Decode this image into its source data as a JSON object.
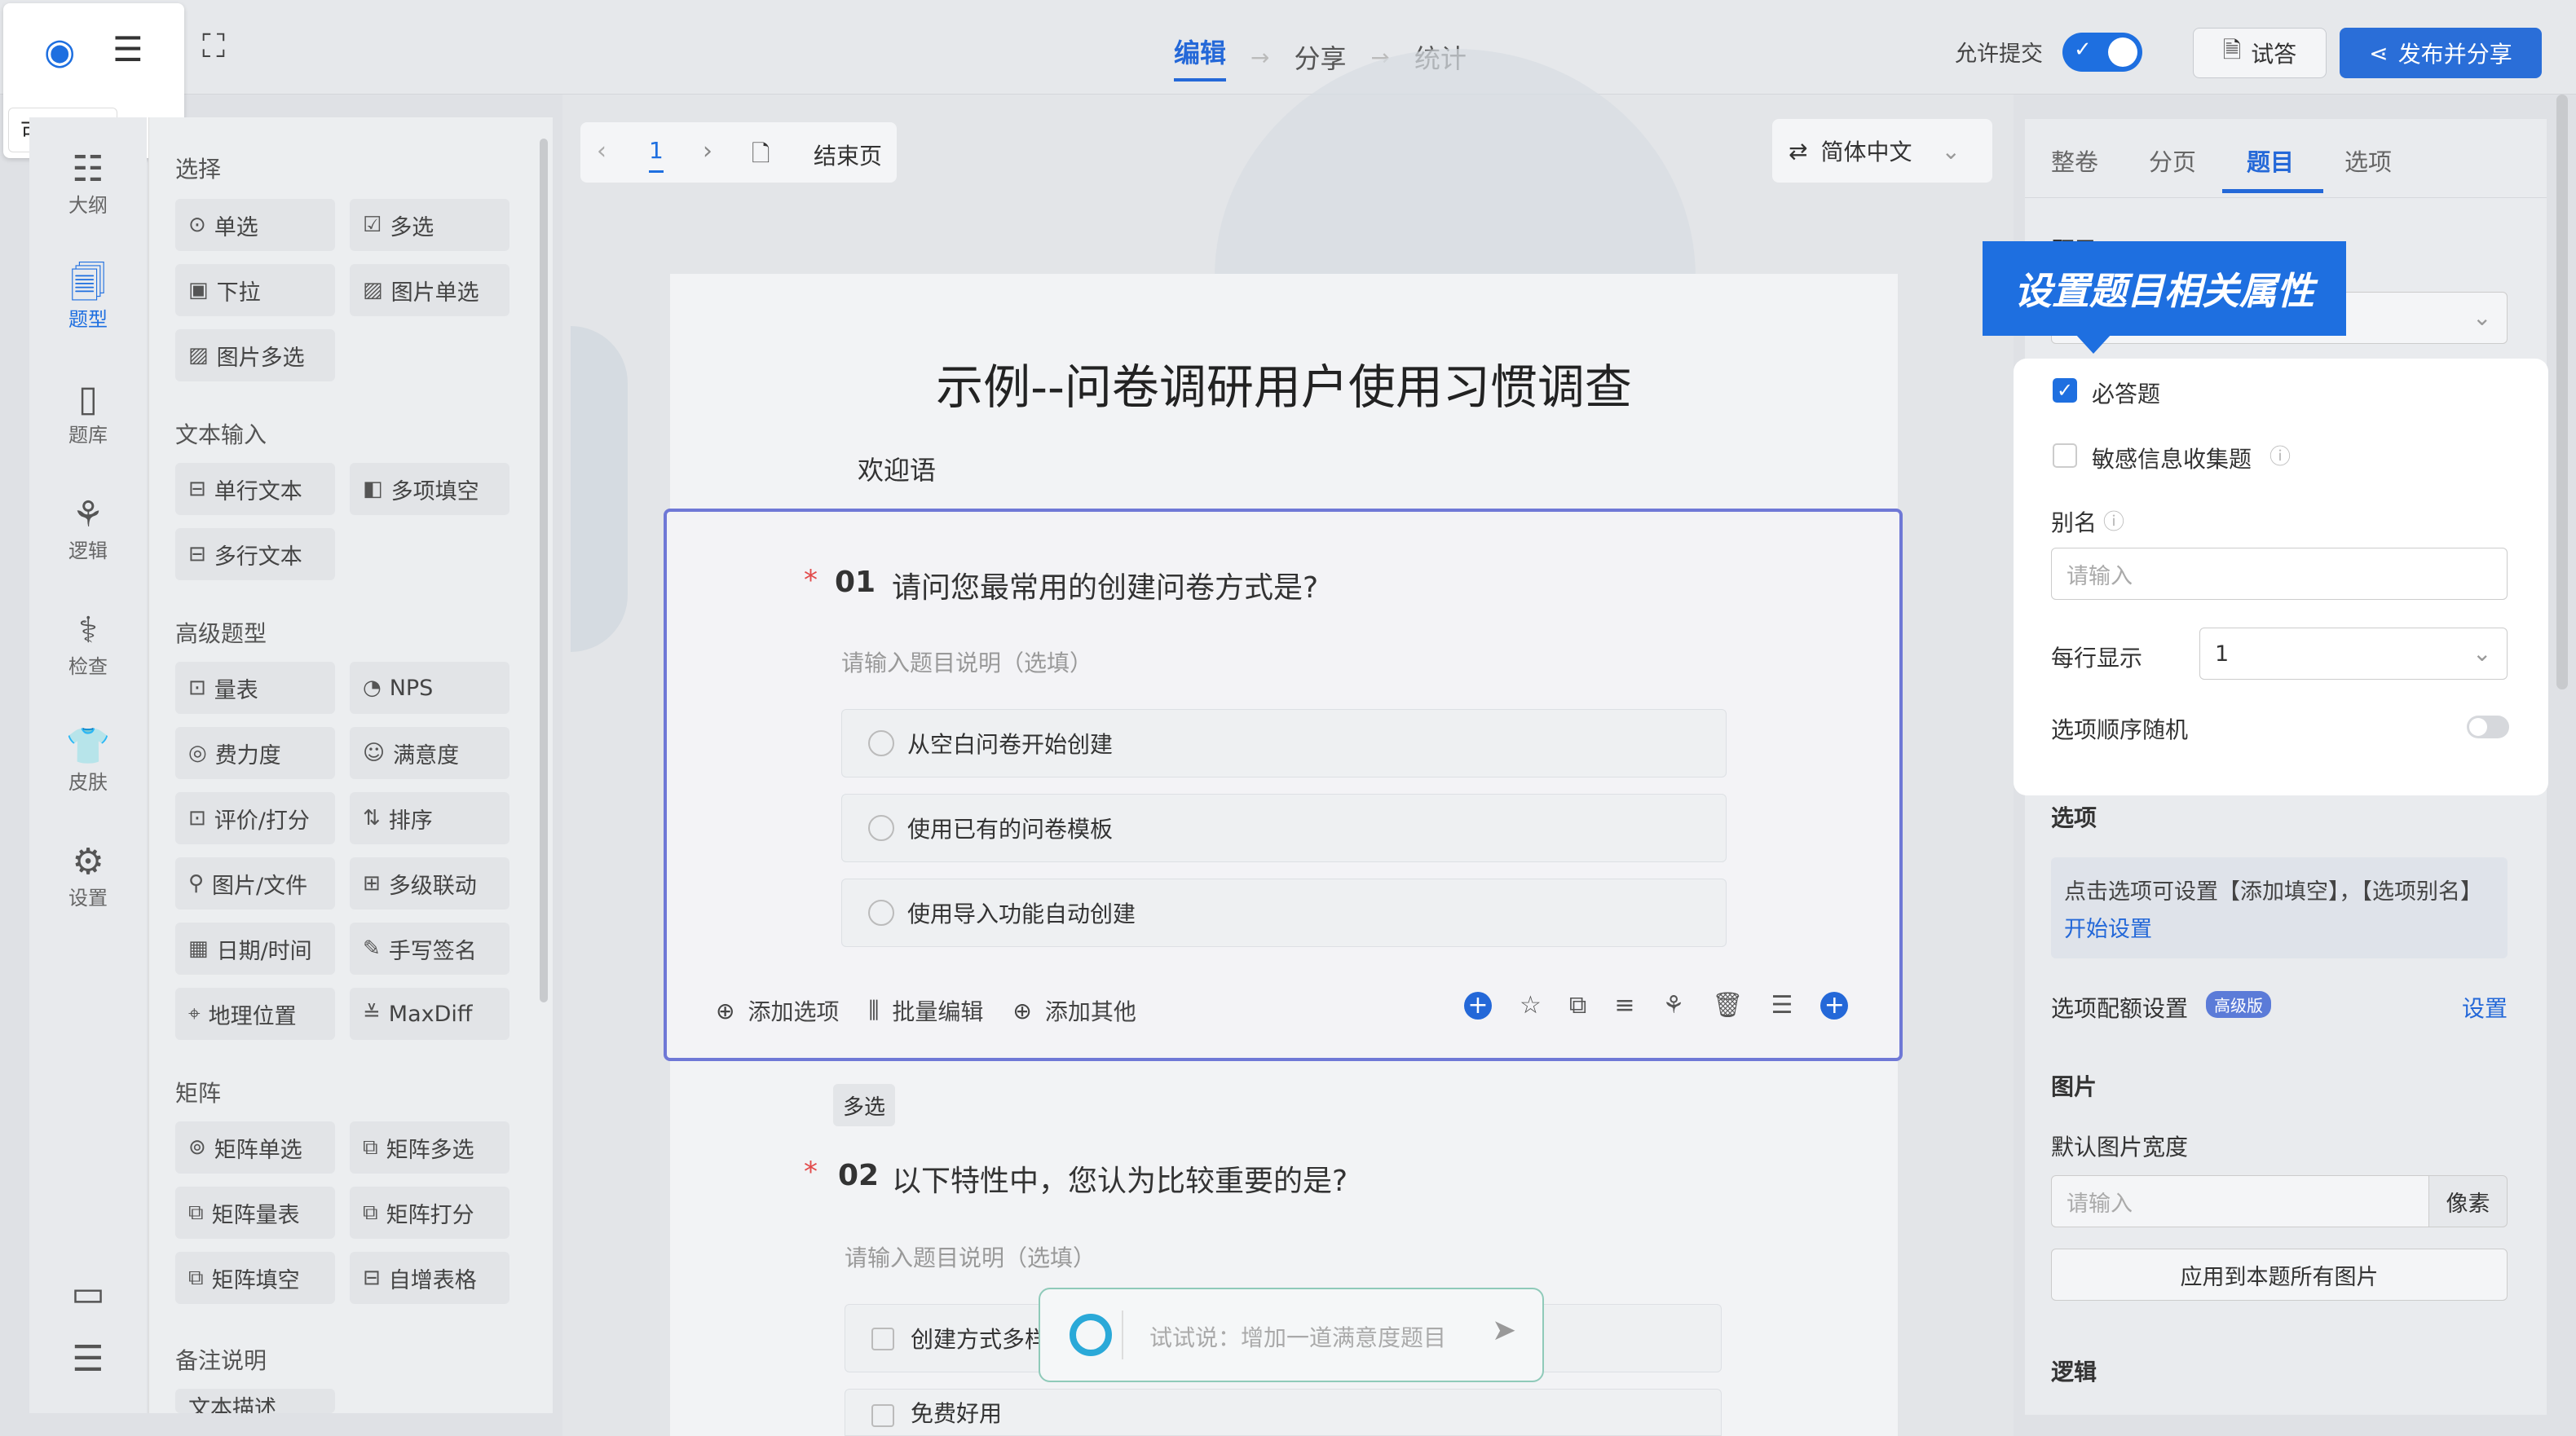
{
  "topbar": {
    "preview_tooltip": "可视模式",
    "steps": [
      "编辑",
      "分享",
      "统计"
    ],
    "allow_submit_label": "允许提交",
    "try_label": "试答",
    "publish_label": "发布并分享"
  },
  "leftnav": {
    "items": [
      "大纲",
      "题型",
      "题库",
      "逻辑",
      "检查",
      "皮肤",
      "设置"
    ]
  },
  "question_types": {
    "sections": [
      "选择",
      "文本输入",
      "高级题型",
      "矩阵",
      "备注说明"
    ],
    "choice": [
      "单选",
      "多选",
      "下拉",
      "图片单选",
      "图片多选"
    ],
    "text": [
      "单行文本",
      "多项填空",
      "多行文本"
    ],
    "advanced": [
      "量表",
      "NPS",
      "费力度",
      "满意度",
      "评价/打分",
      "排序",
      "图片/文件",
      "多级联动",
      "日期/时间",
      "手写签名",
      "地理位置",
      "MaxDiff"
    ],
    "matrix": [
      "矩阵单选",
      "矩阵多选",
      "矩阵量表",
      "矩阵打分",
      "矩阵填空",
      "自增表格"
    ],
    "remark_partial": "文本描述"
  },
  "page_nav": {
    "page": "1",
    "end_page": "结束页"
  },
  "language": "简体中文",
  "survey": {
    "title": "示例--问卷调研用户使用习惯调查",
    "welcome": "欢迎语",
    "q1": {
      "number": "01",
      "text": "请问您最常用的创建问卷方式是?",
      "desc_placeholder": "请输入题目说明（选填）",
      "options": [
        "从空白问卷开始创建",
        "使用已有的问卷模板",
        "使用导入功能自动创建"
      ],
      "add_option": "添加选项",
      "batch_edit": "批量编辑",
      "add_other": "添加其他"
    },
    "q2": {
      "type_badge": "多选",
      "number": "02",
      "text": "以下特性中，您认为比较重要的是?",
      "desc_placeholder": "请输入题目说明（选填）",
      "options": [
        "创建方式多样",
        "免费好用"
      ]
    }
  },
  "ai_bar": {
    "placeholder": "试试说：增加一道满意度题目"
  },
  "right_panel": {
    "tabs": [
      "整卷",
      "分页",
      "题目",
      "选项"
    ],
    "active_tab": "题目",
    "callout": "设置题目相关属性",
    "question_section": "题目",
    "required": "必答题",
    "sensitive": "敏感信息收集题",
    "alias_label": "别名",
    "alias_placeholder": "请输入",
    "per_row_label": "每行显示",
    "per_row_value": "1",
    "shuffle_label": "选项顺序随机",
    "options_section": "选项",
    "options_hint": "点击选项可设置【添加填空】，【选项别名】",
    "options_hint_link": "开始设置",
    "quota_label": "选项配额设置",
    "quota_badge": "高级版",
    "quota_link": "设置",
    "image_section": "图片",
    "image_width_label": "默认图片宽度",
    "image_width_placeholder": "请输入",
    "image_width_unit": "像素",
    "apply_all": "应用到本题所有图片",
    "logic_section": "逻辑"
  },
  "colors": {
    "accent": "#1e6fe0",
    "highlight_border": "#6f78d6"
  }
}
